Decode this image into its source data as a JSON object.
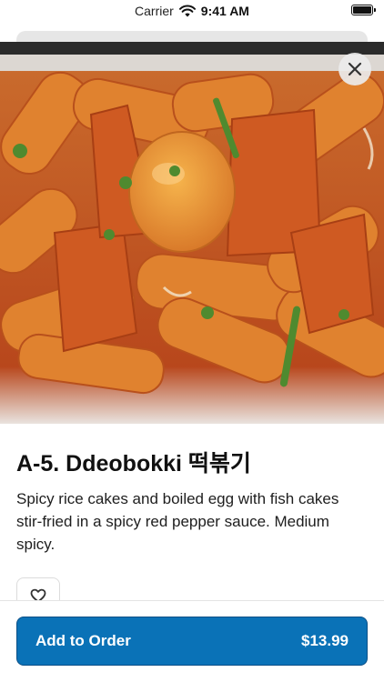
{
  "status_bar": {
    "carrier": "Carrier",
    "time": "9:41 AM"
  },
  "item": {
    "title": "A-5. Ddeobokki 떡볶기",
    "description": "Spicy rice cakes and boiled egg with fish cakes stir-fried in a spicy red pepper sauce. Medium spicy."
  },
  "actions": {
    "add_label": "Add to Order",
    "price": "$13.99"
  },
  "icons": {
    "close": "close-icon",
    "favorite": "heart-icon",
    "wifi": "wifi-icon",
    "battery": "battery-icon"
  },
  "colors": {
    "primary": "#0a72b7",
    "primary_border": "#0b4f86",
    "sauce": "#c75a22"
  }
}
